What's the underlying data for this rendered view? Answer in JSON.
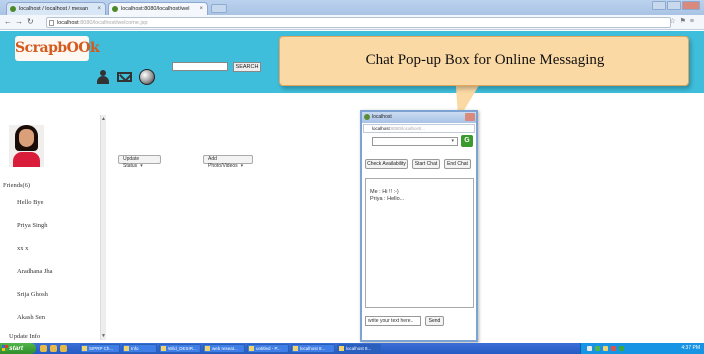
{
  "browser": {
    "tabs": [
      {
        "label": "localhost / localhost / mesan"
      },
      {
        "label": "localhost:8080/localhost/wel"
      }
    ],
    "url_host": "localhost",
    "url_path": ":8080/localhost/welcome.jsp"
  },
  "header": {
    "logo_text": "ScrapbOOk",
    "search_button": "SEARCH",
    "search_value": ""
  },
  "profile": {
    "friends_heading": "Friends(6)",
    "friends": [
      "Hello Bye",
      "Priya Singh",
      "xx x",
      "Aradhana Jha",
      "Srija Ghosh",
      "Akash Sen"
    ],
    "update_info": "Update Info"
  },
  "main": {
    "update_status": "Update Status",
    "add_photos": "Add Photo/Videos"
  },
  "callout": {
    "text": "Chat Pop-up Box for Online Messaging"
  },
  "popup": {
    "title": "localhost",
    "url_host": "localhost",
    "url_path": ":8080/localhost/...",
    "buttons": [
      "Check Availability",
      "Start Chat",
      "End Chat"
    ],
    "messages": [
      "Me : Hi !! :-)",
      "Priya : Hello..."
    ],
    "input_placeholder": "write your text here..",
    "send": "Send"
  },
  "taskbar": {
    "start": "start",
    "tasks": [
      "SIPRP Ch...",
      "Info",
      "Wild_DESIR...",
      "web reseat...",
      "untitled - P...",
      "localhost 8...",
      "localhost 8..."
    ],
    "clock": "4:37 PM"
  }
}
